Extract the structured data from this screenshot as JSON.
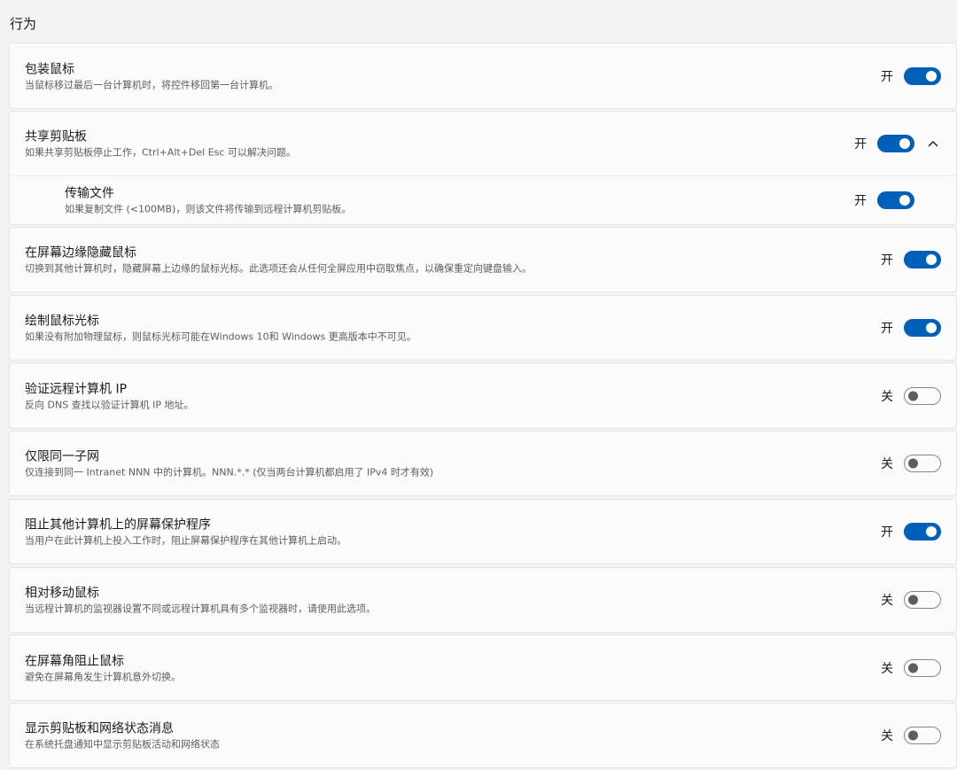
{
  "section": {
    "title": "行为"
  },
  "settings": [
    {
      "title": "包装鼠标",
      "desc": "当鼠标移过最后一台计算机时，将控件移回第一台计算机。",
      "state": "开",
      "on": true
    },
    {
      "title": "共享剪贴板",
      "desc": "如果共享剪贴板停止工作，Ctrl+Alt+Del Esc 可以解决问题。",
      "state": "开",
      "on": true,
      "expanded": true,
      "chevron_icon": "chevron-up-icon",
      "sub": {
        "title": "传输文件",
        "desc": "如果复制文件 (<100MB)，则该文件将传输到远程计算机剪贴板。",
        "state": "开",
        "on": true
      }
    },
    {
      "title": "在屏幕边缘隐藏鼠标",
      "desc": "切换到其他计算机时，隐藏屏幕上边缘的鼠标光标。此选项还会从任何全屏应用中窃取焦点，以确保重定向键盘输入。",
      "state": "开",
      "on": true
    },
    {
      "title": "绘制鼠标光标",
      "desc": "如果没有附加物理鼠标，则鼠标光标可能在Windows 10和 Windows 更高版本中不可见。",
      "state": "开",
      "on": true
    },
    {
      "title": "验证远程计算机 IP",
      "desc": "反向 DNS 查找以验证计算机 IP 地址。",
      "state": "关",
      "on": false
    },
    {
      "title": "仅限同一子网",
      "desc": "仅连接到同一 Intranet NNN 中的计算机。NNN.*.* (仅当两台计算机都启用了 IPv4 时才有效)",
      "state": "关",
      "on": false
    },
    {
      "title": "阻止其他计算机上的屏幕保护程序",
      "desc": "当用户在此计算机上投入工作时，阻止屏幕保护程序在其他计算机上启动。",
      "state": "开",
      "on": true
    },
    {
      "title": "相对移动鼠标",
      "desc": "当远程计算机的监视器设置不同或远程计算机具有多个监视器时，请使用此选项。",
      "state": "关",
      "on": false
    },
    {
      "title": "在屏幕角阻止鼠标",
      "desc": "避免在屏幕角发生计算机意外切换。",
      "state": "关",
      "on": false
    },
    {
      "title": "显示剪贴板和网络状态消息",
      "desc": "在系统托盘通知中显示剪贴板活动和网络状态",
      "state": "关",
      "on": false
    }
  ],
  "colors": {
    "accent": "#005fb8",
    "card_bg": "#fbfbfb",
    "page_bg": "#f3f3f3"
  }
}
